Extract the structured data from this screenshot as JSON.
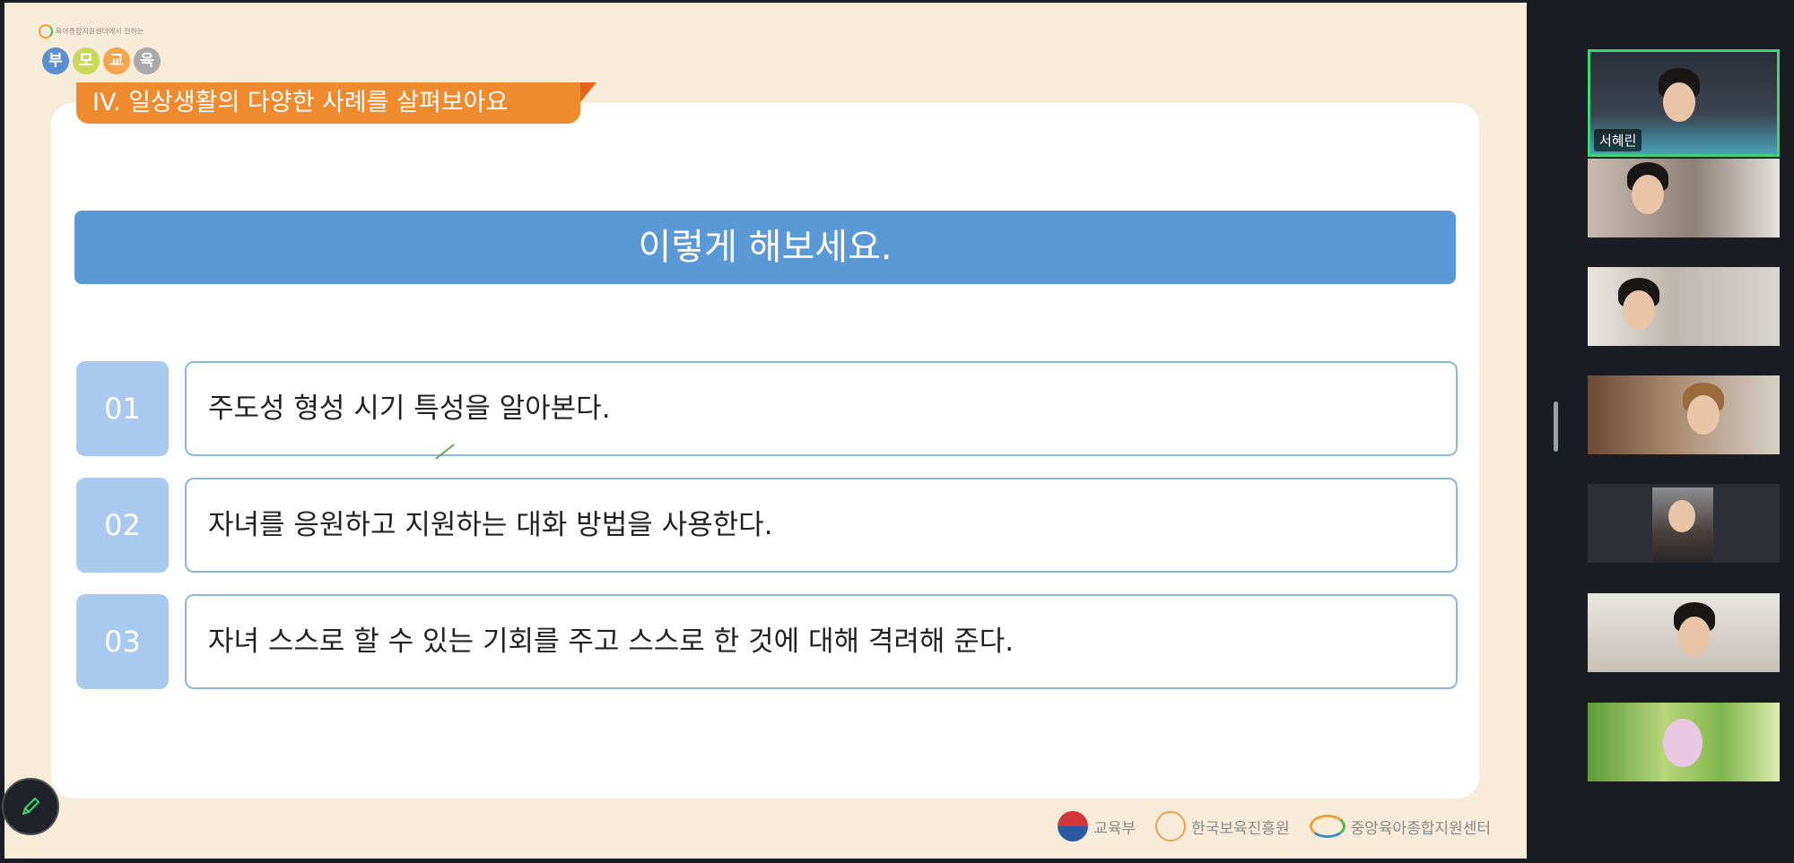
{
  "slide": {
    "brand": {
      "tagline": "육아종합지원센터에서 전하는",
      "letters": [
        "부",
        "모",
        "교",
        "육"
      ]
    },
    "section_title": "IV. 일상생활의 다양한 사례를 살펴보아요",
    "banner": "이렇게 해보세요.",
    "steps": [
      {
        "number": "01",
        "text": "주도성 형성 시기 특성을 알아본다."
      },
      {
        "number": "02",
        "text": "자녀를 응원하고 지원하는 대화 방법을 사용한다."
      },
      {
        "number": "03",
        "text": "자녀 스스로 할 수 있는 기회를 주고 스스로 한 것에 대해 격려해 준다."
      }
    ],
    "footer_logos": [
      "교육부",
      "한국보육진흥원",
      "중앙육아종합지원센터"
    ]
  },
  "annotate_button": {
    "icon": "pencil-icon"
  },
  "participants": [
    {
      "name": "서혜린",
      "active_speaker": true
    },
    {
      "name": ""
    },
    {
      "name": ""
    },
    {
      "name": ""
    },
    {
      "name": ""
    },
    {
      "name": ""
    },
    {
      "name": ""
    }
  ],
  "colors": {
    "slide_bg": "#f7ecd7",
    "tab": "#ef8a2e",
    "banner": "#5b98d6",
    "step_number": "#a9c9ee",
    "step_border": "#8fb5dc",
    "active_speaker": "#3fd47a",
    "app_bg": "#1a1d22"
  }
}
